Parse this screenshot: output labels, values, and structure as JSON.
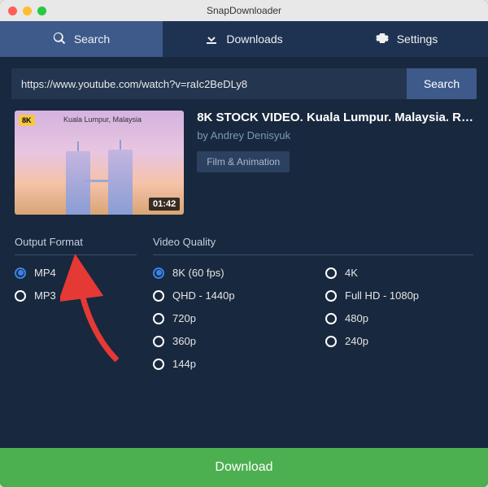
{
  "window": {
    "title": "SnapDownloader"
  },
  "tabs": [
    {
      "label": "Search",
      "icon": "search-icon",
      "active": true
    },
    {
      "label": "Downloads",
      "icon": "download-icon",
      "active": false
    },
    {
      "label": "Settings",
      "icon": "gear-icon",
      "active": false
    }
  ],
  "search": {
    "value": "https://www.youtube.com/watch?v=raIc2BeDLy8",
    "button_label": "Search"
  },
  "video": {
    "badge": "8K",
    "thumb_caption": "Kuala Lumpur, Malaysia",
    "duration": "01:42",
    "title": "8K STOCK VIDEO. Kuala Lumpur. Malaysia. R…",
    "author": "by Andrey Denisyuk",
    "category": "Film & Animation"
  },
  "format": {
    "header": "Output Format",
    "options": [
      "MP4",
      "MP3"
    ],
    "selected": "MP4"
  },
  "quality": {
    "header": "Video Quality",
    "col1": [
      "8K (60 fps)",
      "QHD - 1440p",
      "720p",
      "360p",
      "144p"
    ],
    "col2": [
      "4K",
      "Full HD - 1080p",
      "480p",
      "240p"
    ],
    "selected": "8K (60 fps)"
  },
  "download_label": "Download"
}
